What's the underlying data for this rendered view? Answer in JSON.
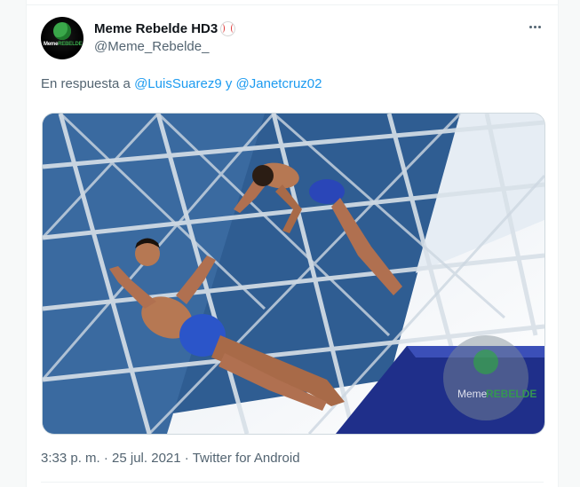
{
  "tweet": {
    "display_name": "Meme Rebelde HD3",
    "handle": "@Meme_Rebelde_",
    "reply_prefix": "En respuesta a",
    "mention1": "@LuisSuarez9",
    "conjunction": "y",
    "mention2": "@Janetcruz02",
    "timestamp": "3:33 p. m. · 25 jul. 2021",
    "separator": "·",
    "source": "Twitter for Android"
  },
  "avatar": {
    "text_a": "Meme",
    "text_b": "REBELDE"
  },
  "watermark": {
    "text_a": "Meme",
    "text_b": "REBELDE"
  },
  "icons": {
    "badge": "baseball-icon",
    "more": "more-icon"
  },
  "colors": {
    "link": "#1d9bf0",
    "secondary": "#536471",
    "primary_text": "#0f1419"
  }
}
